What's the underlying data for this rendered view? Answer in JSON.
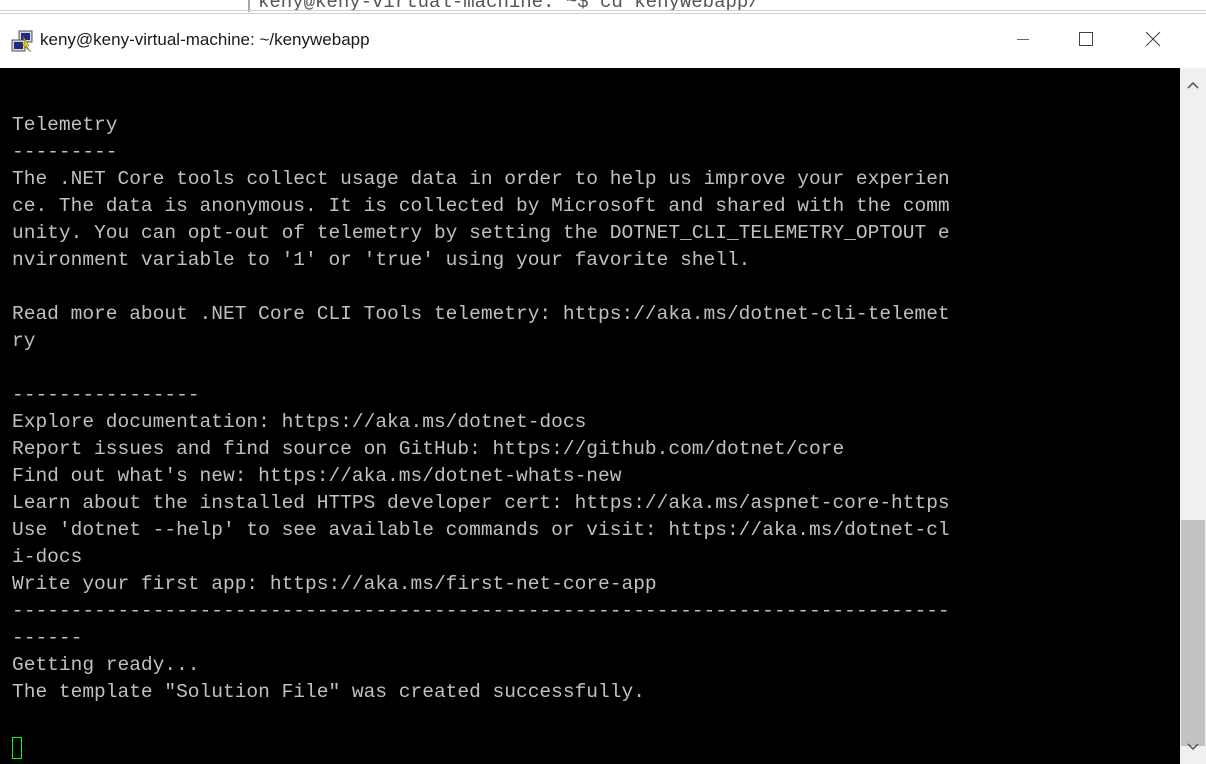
{
  "background": {
    "partial_text": "keny@keny-virtual-machine: ~$ cd kenywebapp/"
  },
  "window": {
    "title": "keny@keny-virtual-machine: ~/kenywebapp",
    "app_icon": "putty-icon",
    "controls": {
      "minimize_icon": "minimize-icon",
      "maximize_icon": "maximize-icon",
      "close_icon": "close-icon"
    }
  },
  "terminal": {
    "lines": [
      "",
      "Telemetry",
      "---------",
      "The .NET Core tools collect usage data in order to help us improve your experien",
      "ce. The data is anonymous. It is collected by Microsoft and shared with the comm",
      "unity. You can opt-out of telemetry by setting the DOTNET_CLI_TELEMETRY_OPTOUT e",
      "nvironment variable to '1' or 'true' using your favorite shell.",
      "",
      "Read more about .NET Core CLI Tools telemetry: https://aka.ms/dotnet-cli-telemet",
      "ry",
      "",
      "----------------",
      "Explore documentation: https://aka.ms/dotnet-docs",
      "Report issues and find source on GitHub: https://github.com/dotnet/core",
      "Find out what's new: https://aka.ms/dotnet-whats-new",
      "Learn about the installed HTTPS developer cert: https://aka.ms/aspnet-core-https",
      "Use 'dotnet --help' to see available commands or visit: https://aka.ms/dotnet-cl",
      "i-docs",
      "Write your first app: https://aka.ms/first-net-core-app",
      "--------------------------------------------------------------------------------",
      "------",
      "Getting ready...",
      "The template \"Solution File\" was created successfully."
    ],
    "text_color": "#c0c0c0",
    "background_color": "#000000",
    "cursor_color": "#00ff00"
  },
  "scrollbar": {
    "up_icon": "scroll-up-arrow-icon",
    "down_icon": "scroll-down-arrow-icon"
  }
}
